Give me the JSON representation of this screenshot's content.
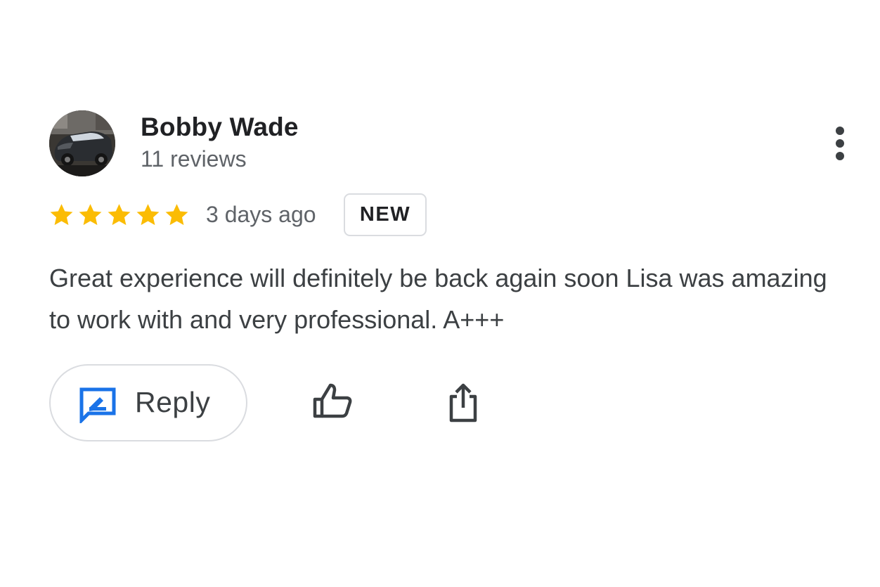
{
  "review": {
    "author_name": "Bobby Wade",
    "review_count": "11 reviews",
    "rating": 5,
    "rating_max": 5,
    "time_ago": "3 days ago",
    "badge": "NEW",
    "text": "Great experience will definitely be back again soon Lisa was amazing to work with and very professional. A+++"
  },
  "actions": {
    "reply_label": "Reply",
    "reply_icon": "reply-edit-icon",
    "like_icon": "thumbs-up-icon",
    "share_icon": "share-icon",
    "more_icon": "more-vertical-icon"
  },
  "colors": {
    "star": "#FBBC04",
    "reply_icon": "#1A73E8",
    "text_primary": "#202124",
    "text_secondary": "#5F6368",
    "border": "#DADCE0"
  }
}
